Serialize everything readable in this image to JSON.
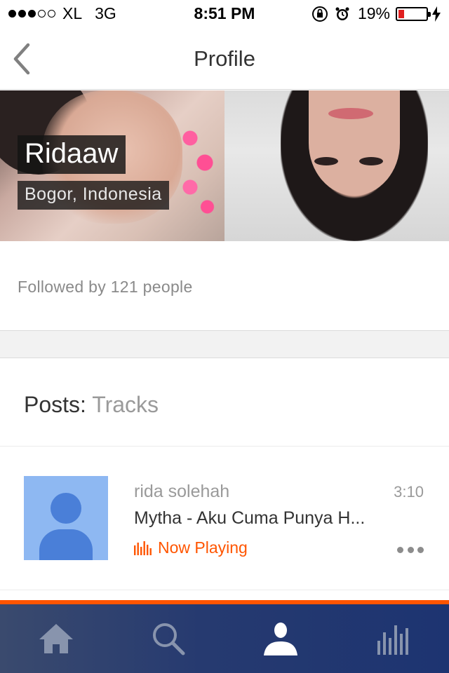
{
  "status_bar": {
    "carrier": "XL",
    "network": "3G",
    "time": "8:51 PM",
    "battery": "19%",
    "battery_level": 0.19,
    "signal_bars_filled": 3,
    "signal_bars_total": 5
  },
  "nav": {
    "title": "Profile",
    "back_icon": "chevron-left-icon"
  },
  "profile": {
    "name": "Ridaaw",
    "location": "Bogor, Indonesia",
    "followers_text": "Followed by 121 people"
  },
  "posts": {
    "label": "Posts:",
    "filter": "Tracks",
    "items": [
      {
        "artist": "rida solehah",
        "duration": "3:10",
        "title": "Mytha - Aku Cuma Punya H...",
        "status": "Now Playing",
        "avatar_icon": "default-user-avatar",
        "more_icon": "more-horizontal-icon"
      }
    ]
  },
  "colors": {
    "accent": "#ff5500",
    "tab_bar": "#263a70",
    "avatar_bg": "#8eb8f2"
  },
  "tab_bar": {
    "tabs": [
      {
        "icon": "home-icon",
        "active": false
      },
      {
        "icon": "search-icon",
        "active": false
      },
      {
        "icon": "profile-icon",
        "active": true
      },
      {
        "icon": "stream-icon",
        "active": false
      }
    ]
  }
}
